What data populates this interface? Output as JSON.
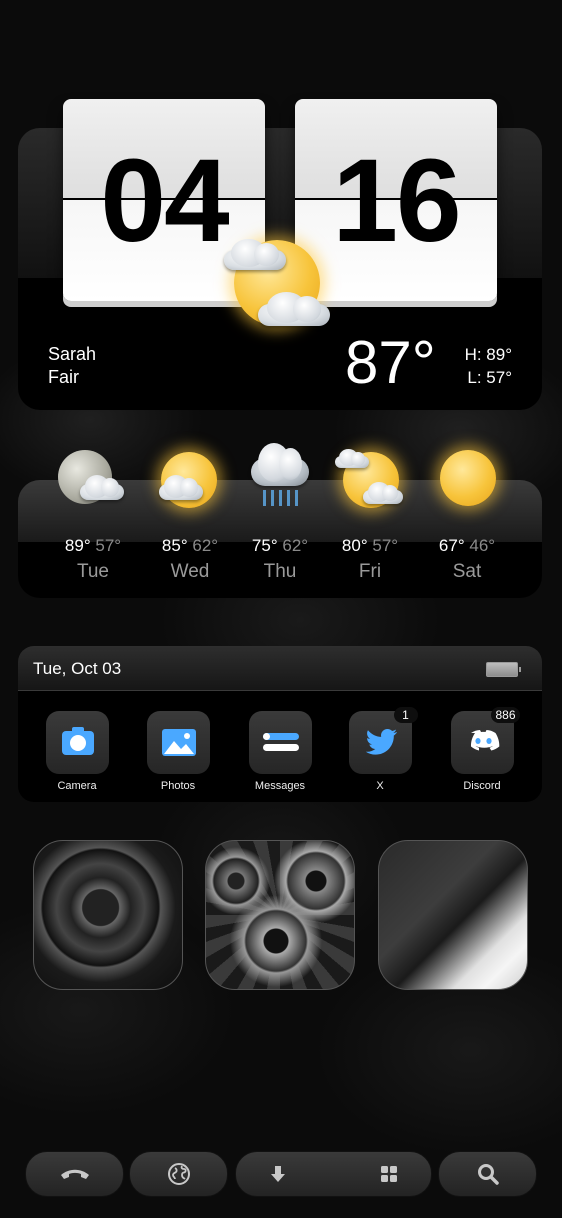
{
  "clock": {
    "hour": "04",
    "minute": "16"
  },
  "weather": {
    "person": "Sarah",
    "condition": "Fair",
    "temperature": "87°",
    "high": "H: 89°",
    "low": "L: 57°"
  },
  "forecast": [
    {
      "day": "Tue",
      "high": "89°",
      "low": "57°",
      "icon": "partly-cloudy-night-icon"
    },
    {
      "day": "Wed",
      "high": "85°",
      "low": "62°",
      "icon": "partly-cloudy-icon"
    },
    {
      "day": "Thu",
      "high": "75°",
      "low": "62°",
      "icon": "thunderstorm-icon"
    },
    {
      "day": "Fri",
      "high": "80°",
      "low": "57°",
      "icon": "partly-cloudy-icon"
    },
    {
      "day": "Sat",
      "high": "67°",
      "low": "46°",
      "icon": "sunny-icon"
    }
  ],
  "dock": {
    "date": "Tue, Oct 03",
    "apps": [
      {
        "label": "Camera",
        "icon": "camera-icon",
        "badge": ""
      },
      {
        "label": "Photos",
        "icon": "photos-icon",
        "badge": ""
      },
      {
        "label": "Messages",
        "icon": "messages-icon",
        "badge": ""
      },
      {
        "label": "X",
        "icon": "twitter-bird-icon",
        "badge": "1"
      },
      {
        "label": "Discord",
        "icon": "discord-icon",
        "badge": "886"
      }
    ]
  },
  "bottom_bar": {
    "icons": [
      "phone-icon",
      "globe-icon",
      "download-icon",
      "grid-icon",
      "search-icon"
    ]
  },
  "colors": {
    "accent_blue": "#4aa8ff",
    "background": "#0b0b0b"
  }
}
